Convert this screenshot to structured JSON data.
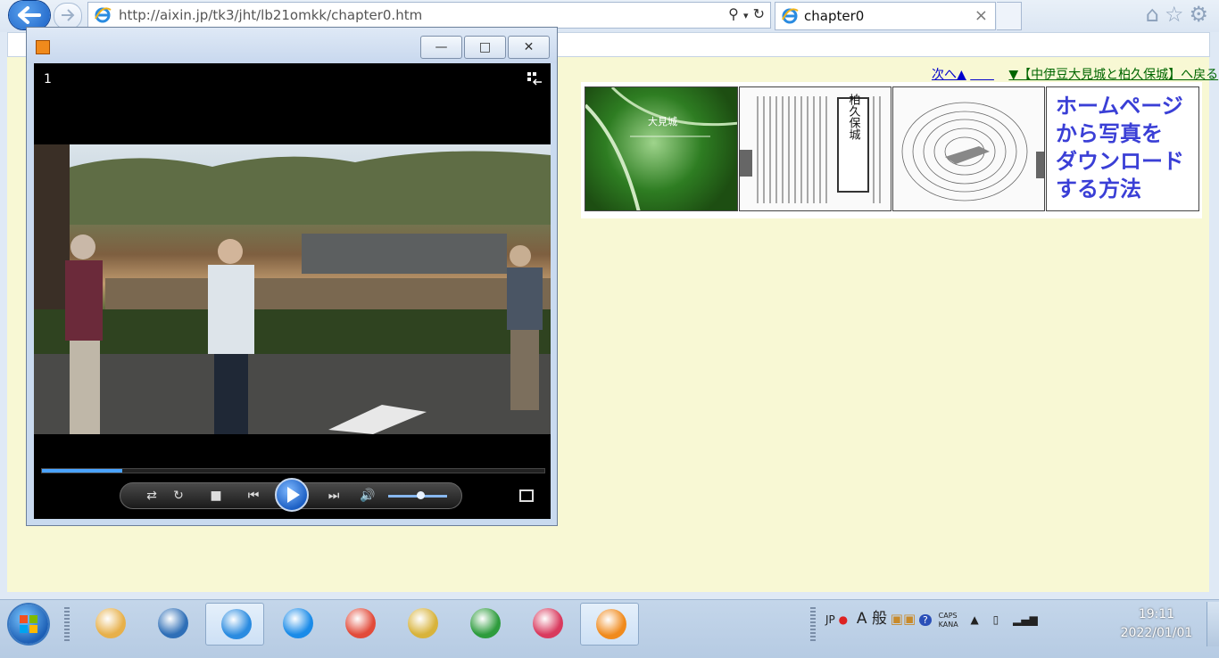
{
  "browser": {
    "url": "http://aixin.jp/tk3/jht/lb21omkk/chapter0.htm",
    "tab_title": "chapter0",
    "tab_close": "×"
  },
  "page": {
    "nav_next": "次へ▲",
    "nav_back": "▼【中伊豆大見城と柏久保城】へ戻る",
    "thumbs": [
      {
        "name": "aerial-map",
        "label": "大見城"
      },
      {
        "name": "book-page",
        "label": "柏久保城"
      },
      {
        "name": "contour-map",
        "label": ""
      },
      {
        "name": "download-howto",
        "label": "ホームページから写真をダウンロードする方法"
      }
    ],
    "download_howto_lines": [
      "ホームページ",
      "から写真を",
      "ダウンロード",
      "する方法"
    ]
  },
  "player": {
    "video_number": "1",
    "seek_progress_percent": 16,
    "volume_percent": 55,
    "window_buttons": {
      "minimize": "—",
      "maximize": "□",
      "close": "✕"
    }
  },
  "taskbar": {
    "apps": [
      {
        "name": "paint-icon",
        "color": "#e7b04a"
      },
      {
        "name": "thunderbird-icon",
        "color": "#2f6fb7"
      },
      {
        "name": "ie-icon",
        "color": "#2a8be0",
        "active": true
      },
      {
        "name": "drop-icon",
        "color": "#1a8be8"
      },
      {
        "name": "chrome-icon",
        "color": "#e24b3a"
      },
      {
        "name": "file-manager-icon",
        "color": "#d8b33b"
      },
      {
        "name": "ffftp-icon",
        "color": "#2e9c3d"
      },
      {
        "name": "scissors-icon",
        "color": "#d93a5e"
      },
      {
        "name": "wmp-icon",
        "color": "#f08a1c",
        "active": true
      }
    ],
    "tray": {
      "lang": "JP",
      "ime_mode": "A 般",
      "caps": "CAPS",
      "kana": "KANA"
    },
    "clock": {
      "time": "19:11",
      "date": "2022/01/01"
    }
  }
}
